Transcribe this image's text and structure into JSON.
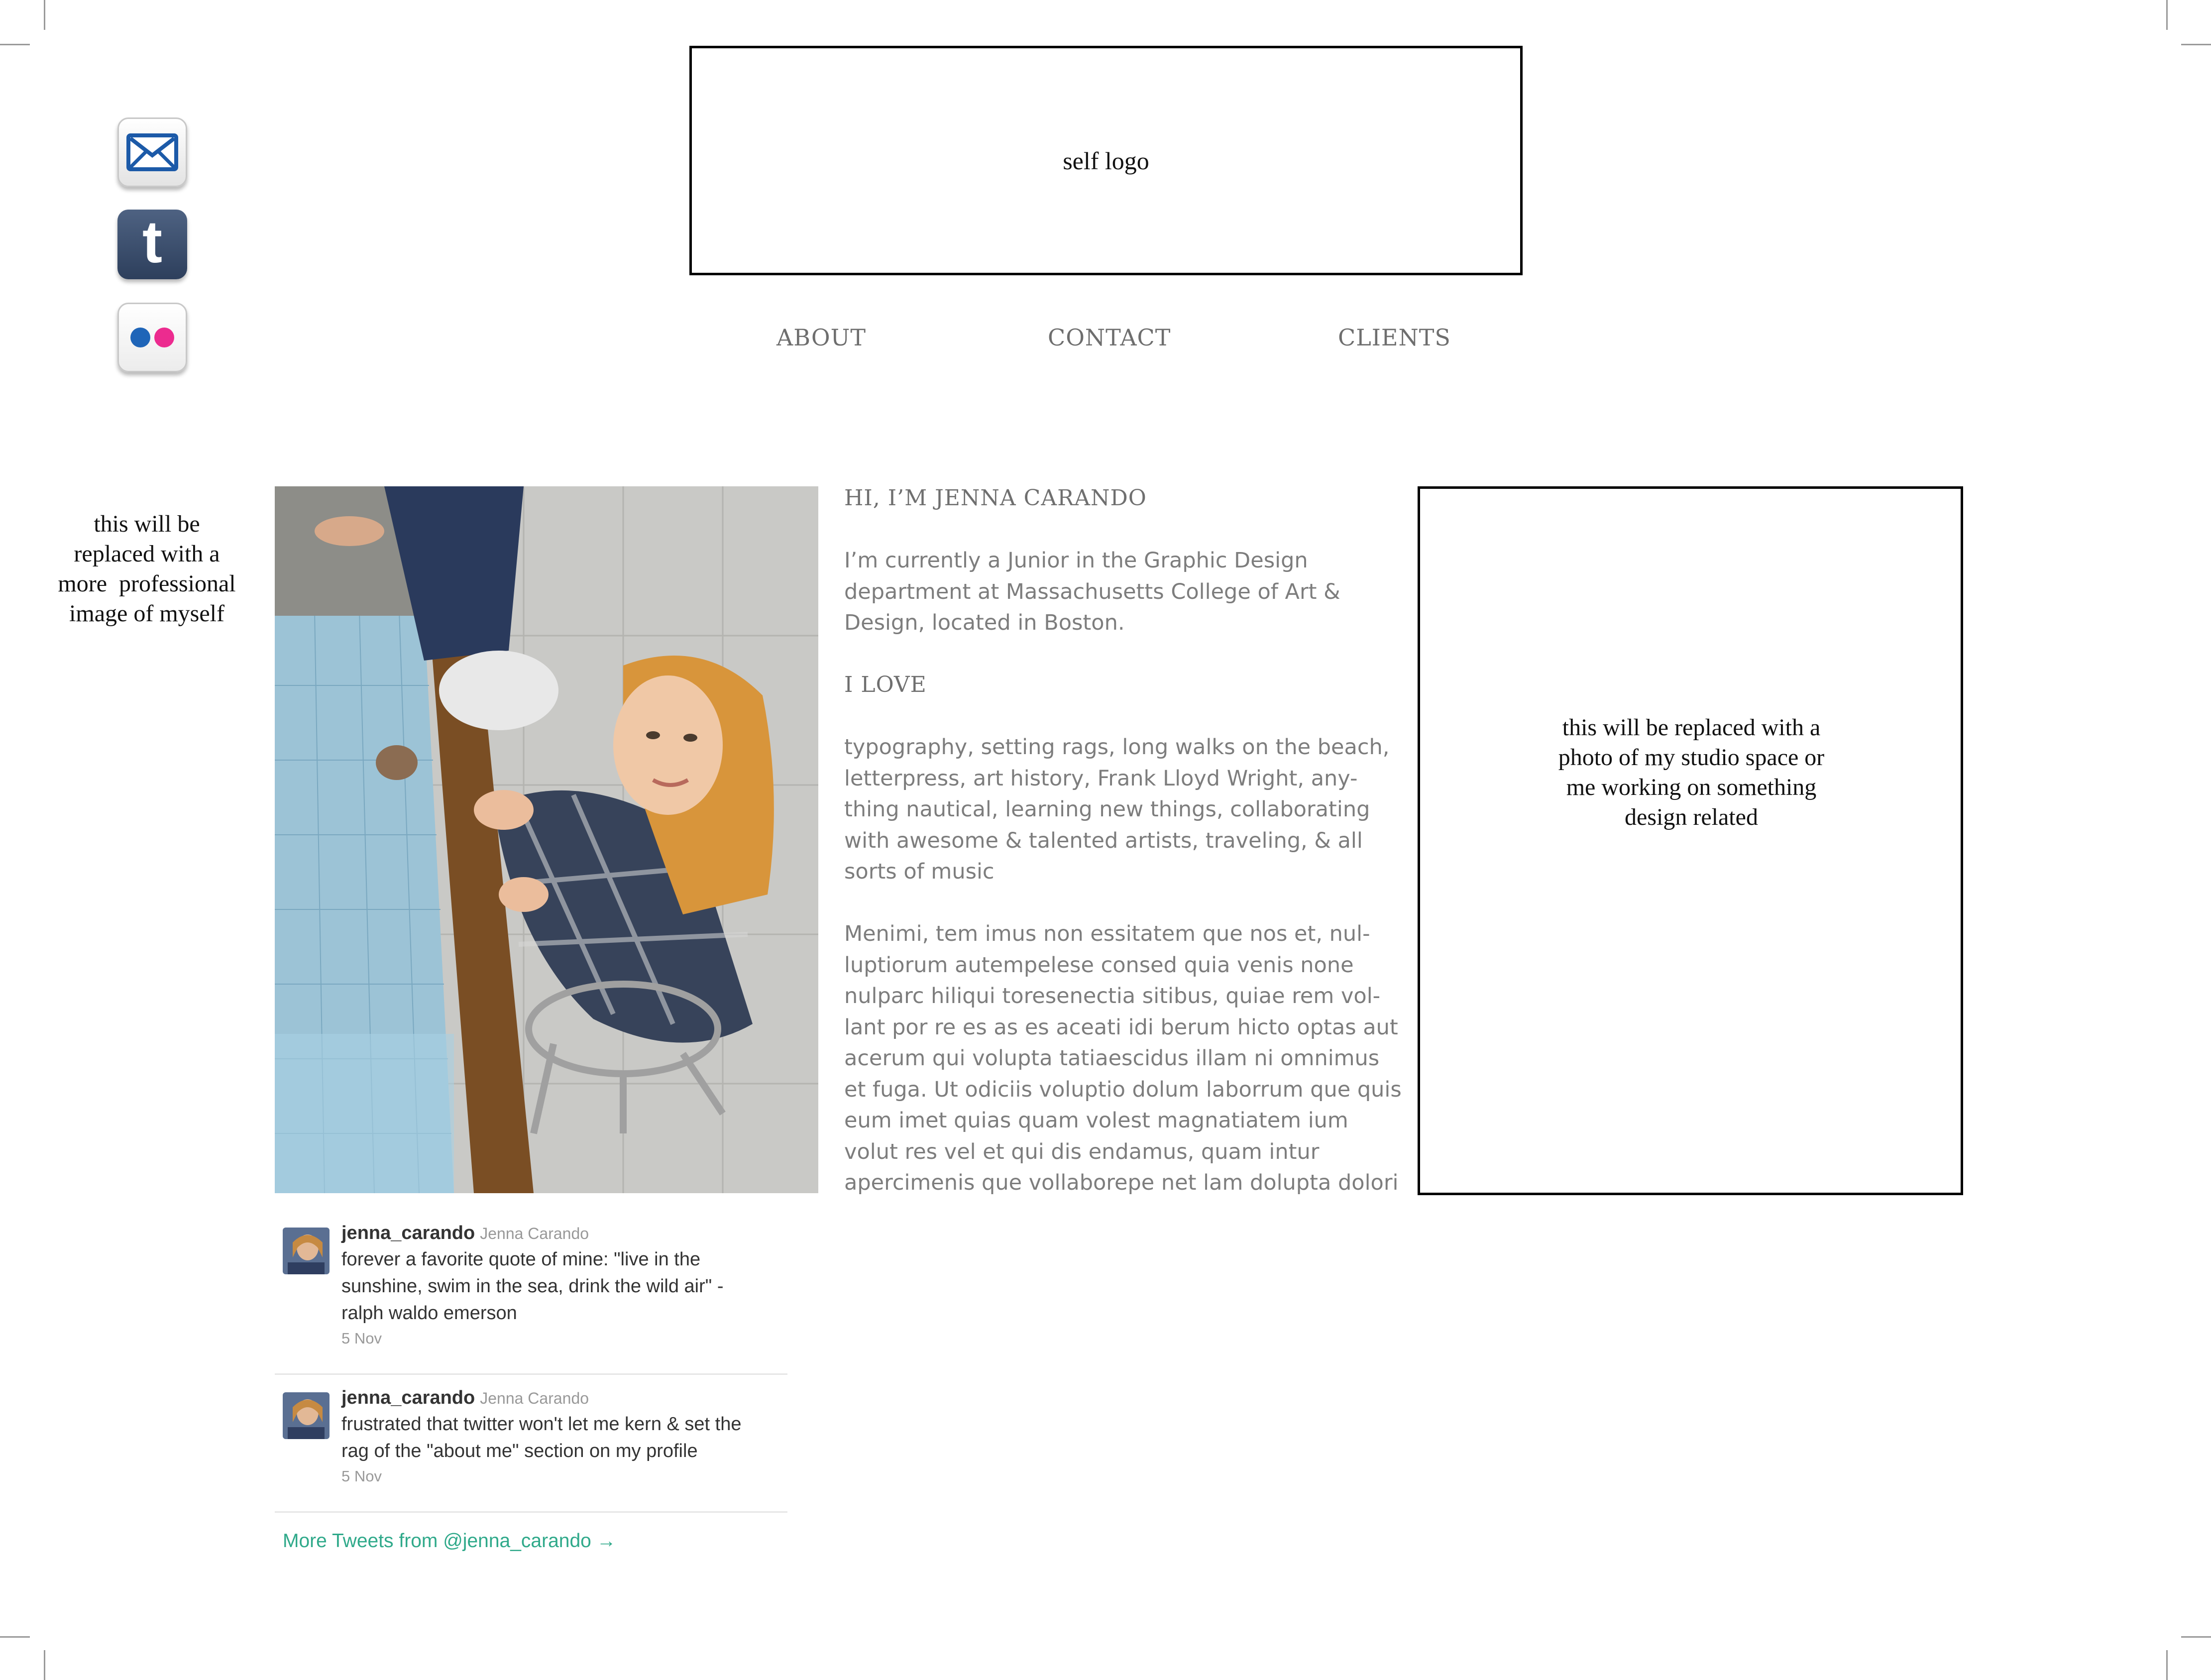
{
  "social": {
    "email_icon": "envelope-icon",
    "tumblr_icon": "tumblr-t-icon",
    "tumblr_glyph": "t",
    "flickr_icon": "flickr-dots-icon",
    "flickr_colors": [
      "#1f65b8",
      "#ec2b8f"
    ]
  },
  "header": {
    "logo_text": "self logo"
  },
  "nav": {
    "items": [
      {
        "label": "ABOUT"
      },
      {
        "label": "CONTACT"
      },
      {
        "label": "CLIENTS"
      }
    ]
  },
  "sidebar_note": {
    "lines": [
      "this will be",
      "replaced with a",
      "more  professional",
      "image of myself"
    ]
  },
  "about": {
    "greeting": "HI, I’M JENNA CARANDO",
    "intro": "I’m  currently a Junior in the Graphic Design department at Massachusetts College of Art & Design, located in Boston.",
    "love_heading": "I LOVE",
    "love_text": "typography, setting rags, long walks on the beach, letterpress, art history, Frank Lloyd Wright, any-thing nautical, learning new things, collaborating with awesome & talented artists, traveling, & all sorts of music",
    "filler_text": "Menimi, tem imus non essitatem que nos et, nul-luptiorum autempelese consed quia venis none nulparc hiliqui toresenectia sitibus, quiae rem vol-lant por re es as es aceati idi berum hicto optas aut acerum qui volupta tatiaescidus illam ni omnimus et fuga. Ut odiciis voluptio dolum laborrum que quis eum imet quias quam volest magnatiatem ium volut res vel et qui dis endamus, quam intur apercimenis que vollaborepe net lam dolupta dolori"
  },
  "studio_note": {
    "lines": [
      "this will be replaced with a",
      "photo of my studio space or",
      "me working on something",
      "design related"
    ]
  },
  "tweets": [
    {
      "username": "jenna_carando",
      "name": "Jenna Carando",
      "lines": [
        "forever a favorite quote of mine: \"live in the",
        "sunshine, swim in the sea, drink the wild air\" -",
        "ralph waldo emerson"
      ],
      "date": "5 Nov"
    },
    {
      "username": "jenna_carando",
      "name": "Jenna Carando",
      "lines": [
        "frustrated that twitter won't let me kern & set the",
        "rag of the \"about me\" section on my profile"
      ],
      "date": "5 Nov"
    }
  ],
  "more_tweets": {
    "label": "More Tweets from @jenna_carando →"
  },
  "colors": {
    "nav_text": "#6e6e6e",
    "body_text": "#7d7d7d",
    "link_green": "#2fa98a"
  }
}
